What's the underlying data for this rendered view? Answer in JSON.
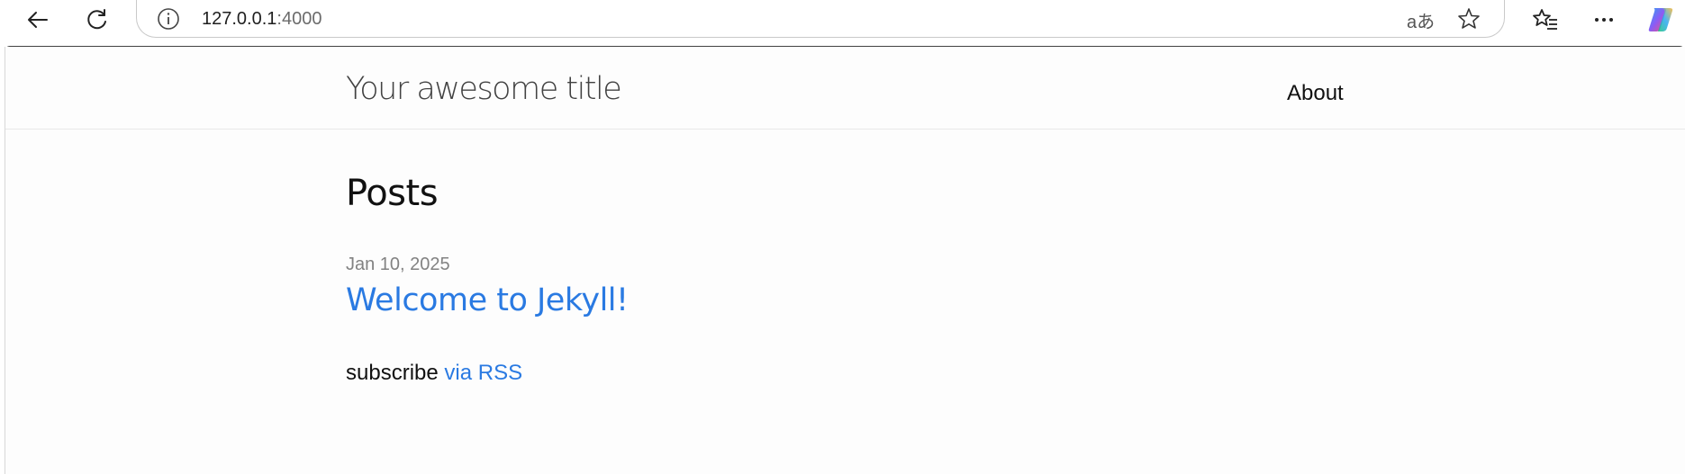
{
  "browser": {
    "url_host": "127.0.0.1",
    "url_port": ":4000",
    "translate_glyph": "aあ",
    "icons": [
      "back-icon",
      "reload-icon",
      "info-icon",
      "translate-icon",
      "favorite-star-icon",
      "favorites-list-icon",
      "more-icon",
      "copilot-icon"
    ]
  },
  "site": {
    "title": "Your awesome title",
    "nav": {
      "about": "About"
    },
    "heading": "Posts",
    "posts": [
      {
        "date": "Jan 10, 2025",
        "title": "Welcome to Jekyll!"
      }
    ],
    "subscribe": {
      "prefix": "subscribe",
      "link": "via RSS"
    }
  },
  "colors": {
    "link": "#2a7ae2",
    "meta": "#828282",
    "text": "#111111",
    "title": "#424242"
  }
}
